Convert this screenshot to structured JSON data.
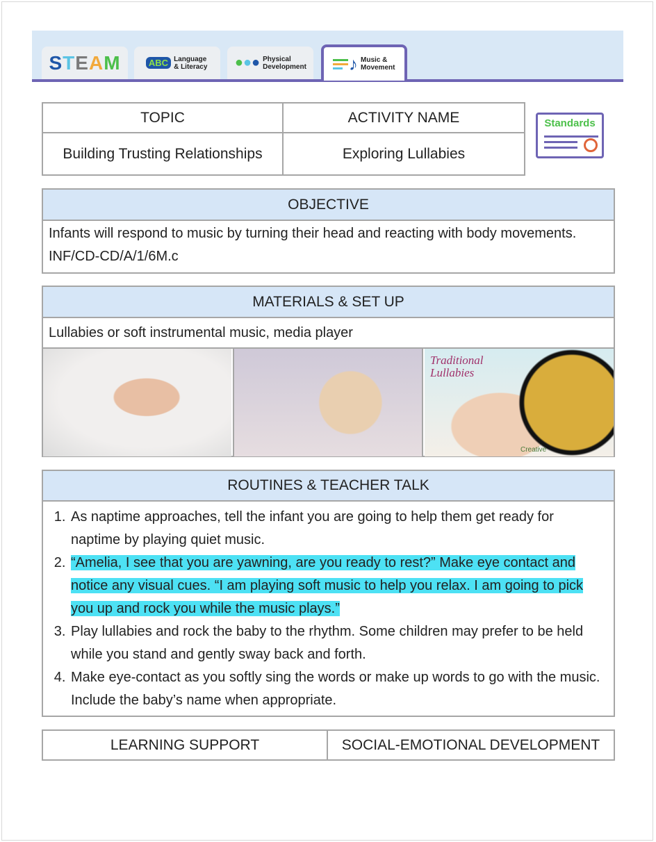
{
  "tabs": [
    {
      "label": "STEAM",
      "icon": "steam-logo"
    },
    {
      "label": "Language & Literacy",
      "icon": "abc-icon"
    },
    {
      "label": "Physical Development",
      "icon": "physical-development-icon"
    },
    {
      "label": "Music & Movement",
      "icon": "music-note-icon",
      "active": true
    }
  ],
  "summary": {
    "topic_header": "TOPIC",
    "activity_header": "ACTIVITY NAME",
    "topic": "Building Trusting Relationships",
    "activity": "Exploring Lullabies"
  },
  "standards_badge": "Standards",
  "objective": {
    "header": "OBJECTIVE",
    "text": "Infants will respond to music by turning their head and reacting with body movements.",
    "code": "INF/CD-CD/A/1/6M.c"
  },
  "materials": {
    "header": "MATERIALS & SET UP",
    "text": "Lullabies or soft instrumental music, media player",
    "images": [
      "sleeping-baby-photo",
      "teddy-bear-headphones-photo",
      "traditional-lullabies-cd-cover"
    ],
    "cd_title": "Traditional Lullabies",
    "cd_brand": "Creative"
  },
  "routines": {
    "header": "ROUTINES & TEACHER TALK",
    "items": [
      "As naptime approaches, tell the infant you are going to help them get ready for naptime by playing quiet music.",
      "“Amelia, I see that you are yawning, are you ready to rest?” Make eye contact and notice any visual cues. “I am playing soft music to help you relax. I am going to pick you up and rock you while the music plays.”",
      "Play lullabies and rock the baby to the rhythm. Some children may prefer to be held while you stand and gently sway back and forth.",
      "Make eye-contact as you softly sing the words or make up words to go with the music. Include the baby’s name when appropriate."
    ]
  },
  "bottom": {
    "left": "LEARNING SUPPORT",
    "right": "SOCIAL-EMOTIONAL DEVELOPMENT"
  },
  "colors": {
    "accent": "#6e64b4",
    "header_bg": "#d6e6f7",
    "highlight": "#4de1f4",
    "standards_green": "#4cc04a"
  }
}
